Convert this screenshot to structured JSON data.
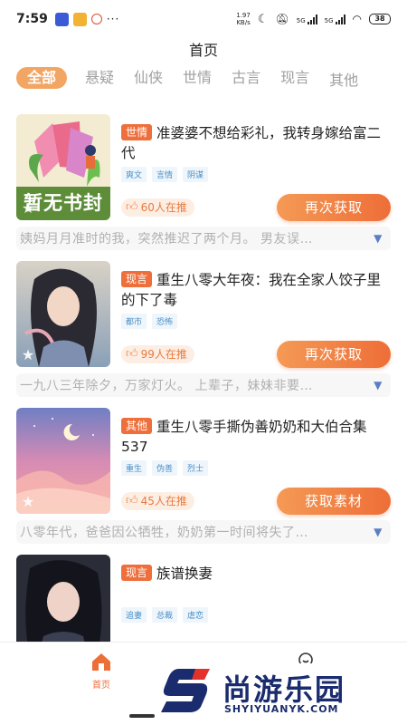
{
  "status_bar": {
    "time": "7:59",
    "dots": "···",
    "net_speed": "1.97",
    "net_unit": "KB/s",
    "sim1": "5G",
    "sim2": "5G",
    "battery": "38"
  },
  "nav": {
    "title": "首页"
  },
  "categories": {
    "items": [
      "全部",
      "悬疑",
      "仙侠",
      "世情",
      "古言",
      "现言",
      "其他"
    ],
    "active_index": 0
  },
  "books": [
    {
      "genre": "世情",
      "title": "准婆婆不想给彩礼，我转身嫁给富二代",
      "tags": [
        "爽文",
        "言情",
        "阴谋"
      ],
      "recommend": "60人在推",
      "button": "再次获取",
      "summary": "姨妈月月准时的我，突然推迟了两个月。 男友误…",
      "cover_text": "暂无书封"
    },
    {
      "genre": "现言",
      "title": "重生八零大年夜：我在全家人饺子里的下了毒",
      "tags": [
        "都市",
        "恐怖"
      ],
      "recommend": "99人在推",
      "button": "再次获取",
      "summary": "一九八三年除夕，万家灯火。 上辈子，妹妹非要…"
    },
    {
      "genre": "其他",
      "title": "重生八零手撕伪善奶奶和大伯合集537",
      "tags": [
        "重生",
        "伪善",
        "烈士"
      ],
      "recommend": "45人在推",
      "button": "获取素材",
      "summary": "八零年代，爸爸因公牺牲，奶奶第一时间将失了…"
    },
    {
      "genre": "现言",
      "title": "族谱换妻",
      "tags": [
        "追妻",
        "总裁",
        "虐恋"
      ]
    }
  ],
  "tabbar": {
    "home_label": "首页"
  },
  "watermark": {
    "text": "尚游乐园",
    "url": "SHYIYUANYK.COM"
  },
  "colors": {
    "accent": "#ee6e38",
    "tab_active_bg": "#f3a563",
    "tag_blue": "#4a90c8"
  }
}
